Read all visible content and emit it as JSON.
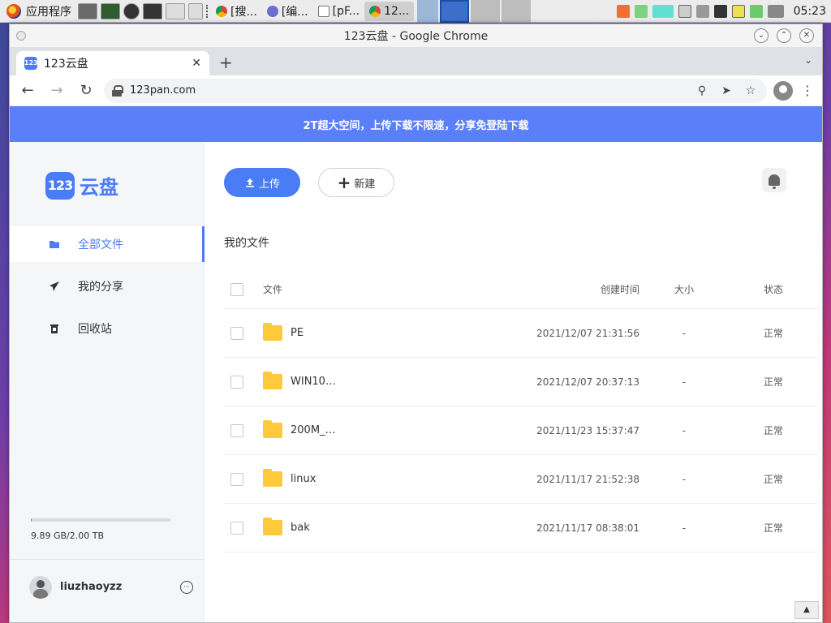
{
  "taskbar": {
    "launcher_label": "应用程序",
    "tasks": [
      {
        "label": "[搜..."
      },
      {
        "label": "[编..."
      },
      {
        "label": "[pF..."
      },
      {
        "label": "12..."
      }
    ],
    "clock": "05:23"
  },
  "window": {
    "title": "123云盘 - Google Chrome"
  },
  "browser": {
    "tab_title": "123云盘",
    "tab_favicon_text": "123",
    "url": "123pan.com"
  },
  "banner": {
    "text": "2T超大空间，上传下载不限速，分享免登陆下载"
  },
  "sidebar": {
    "brand_badge": "123",
    "brand_text": "云盘",
    "items": [
      {
        "label": "全部文件",
        "icon": "folder-icon",
        "active": true
      },
      {
        "label": "我的分享",
        "icon": "send-icon",
        "active": false
      },
      {
        "label": "回收站",
        "icon": "trash-icon",
        "active": false
      }
    ],
    "storage": {
      "text": "9.89 GB/2.00 TB",
      "used_fraction": 0.005
    },
    "user": {
      "name": "liuzhaoyzz",
      "more_label": "···"
    }
  },
  "main": {
    "upload_label": "上传",
    "new_label": "新建",
    "section_title": "我的文件",
    "columns": {
      "name": "文件",
      "time": "创建时间",
      "size": "大小",
      "status": "状态"
    },
    "files": [
      {
        "name": "PE",
        "time": "2021/12/07 21:31:56",
        "size": "-",
        "status": "正常"
      },
      {
        "name": "WIN10…",
        "time": "2021/12/07 20:37:13",
        "size": "-",
        "status": "正常"
      },
      {
        "name": "200M_…",
        "time": "2021/11/23 15:37:47",
        "size": "-",
        "status": "正常"
      },
      {
        "name": "linux",
        "time": "2021/11/17 21:52:38",
        "size": "-",
        "status": "正常"
      },
      {
        "name": "bak",
        "time": "2021/11/17 08:38:01",
        "size": "-",
        "status": "正常"
      }
    ]
  },
  "colors": {
    "accent": "#4a7cf6",
    "banner": "#5b7ff9",
    "folder": "#ffc93c"
  }
}
